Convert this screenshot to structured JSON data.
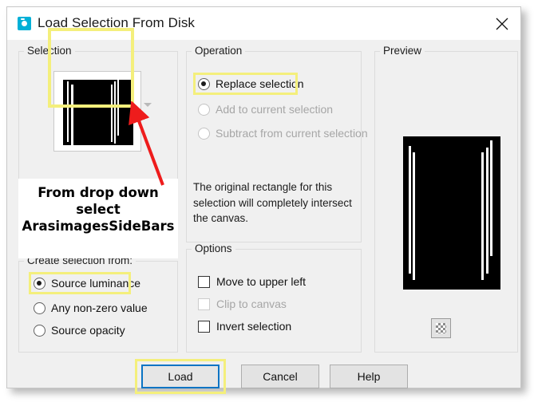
{
  "window": {
    "title": "Load Selection From Disk",
    "icon": "camera-icon",
    "close_label": "×"
  },
  "selection": {
    "group_title": "Selection",
    "thumbnail_alt": "selection-thumbnail",
    "dropdown_icon": "chevron-down-icon",
    "note_lines": [
      "From drop down",
      "select",
      "ArasimagesSideBars"
    ],
    "annotation_arrow": "red-arrow",
    "highlight_color": "#f4ef7c"
  },
  "create_from": {
    "group_title": "Create selection from:",
    "options": [
      {
        "label": "Source luminance",
        "checked": true,
        "disabled": false,
        "highlighted": true
      },
      {
        "label": "Any non-zero value",
        "checked": false,
        "disabled": false,
        "highlighted": false
      },
      {
        "label": "Source opacity",
        "checked": false,
        "disabled": false,
        "highlighted": false
      }
    ]
  },
  "operation": {
    "group_title": "Operation",
    "options": [
      {
        "label": "Replace selection",
        "checked": true,
        "disabled": false,
        "highlighted": true
      },
      {
        "label": "Add to current selection",
        "checked": false,
        "disabled": true,
        "highlighted": false
      },
      {
        "label": "Subtract from current selection",
        "checked": false,
        "disabled": true,
        "highlighted": false
      }
    ],
    "hint": "The original rectangle for this selection will completely intersect the canvas."
  },
  "options": {
    "group_title": "Options",
    "items": [
      {
        "label": "Move to upper left",
        "checked": false,
        "disabled": false
      },
      {
        "label": "Clip to canvas",
        "checked": false,
        "disabled": true
      },
      {
        "label": "Invert selection",
        "checked": false,
        "disabled": false
      }
    ]
  },
  "preview": {
    "group_title": "Preview",
    "image_alt": "selection-preview",
    "transparency_icon": "checkerboard-icon"
  },
  "buttons": {
    "load": "Load",
    "cancel": "Cancel",
    "help": "Help"
  },
  "colors": {
    "accent_blue": "#0a74c4",
    "highlight_yellow": "#f4ef7c",
    "arrow_red": "#ee1c1c",
    "title_icon": "#00b0d7"
  }
}
